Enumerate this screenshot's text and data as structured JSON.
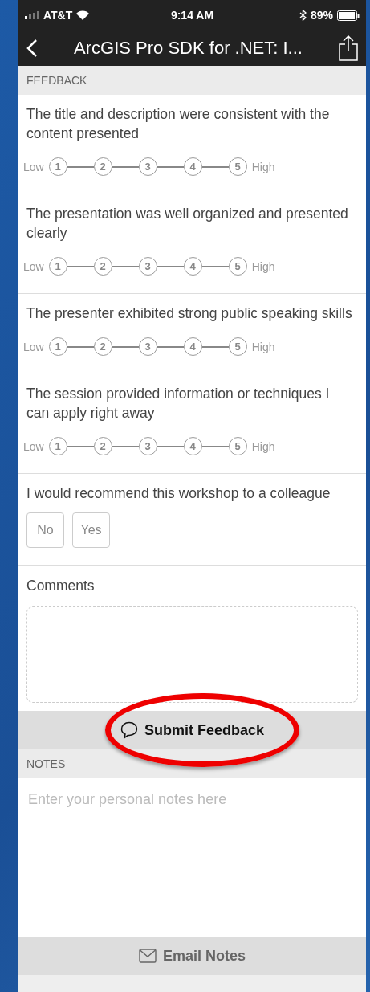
{
  "status_bar": {
    "carrier": "AT&T",
    "time": "9:14 AM",
    "battery": "89%"
  },
  "nav": {
    "title": "ArcGIS Pro SDK for .NET: I..."
  },
  "feedback": {
    "header": "FEEDBACK",
    "questions": [
      {
        "kind": "rating",
        "text": "The title and description were consistent with the content presented",
        "low": "Low",
        "high": "High",
        "options": [
          {
            "label": "1",
            "selected": false
          },
          {
            "label": "2",
            "selected": false
          },
          {
            "label": "3",
            "selected": false
          },
          {
            "label": "4",
            "selected": false
          },
          {
            "label": "5",
            "selected": false
          }
        ]
      },
      {
        "kind": "rating",
        "text": "The presentation was well organized and presented clearly",
        "low": "Low",
        "high": "High",
        "options": [
          {
            "label": "1",
            "selected": false
          },
          {
            "label": "2",
            "selected": false
          },
          {
            "label": "3",
            "selected": false
          },
          {
            "label": "4",
            "selected": false
          },
          {
            "label": "5",
            "selected": false
          }
        ]
      },
      {
        "kind": "rating",
        "text": "The presenter exhibited strong public speaking skills",
        "low": "Low",
        "high": "High",
        "options": [
          {
            "label": "1",
            "selected": false
          },
          {
            "label": "2",
            "selected": false
          },
          {
            "label": "3",
            "selected": false
          },
          {
            "label": "4",
            "selected": false
          },
          {
            "label": "5",
            "selected": false
          }
        ]
      },
      {
        "kind": "rating",
        "text": "The session provided information or techniques I can apply right away",
        "low": "Low",
        "high": "High",
        "options": [
          {
            "label": "1",
            "selected": false
          },
          {
            "label": "2",
            "selected": false
          },
          {
            "label": "3",
            "selected": false
          },
          {
            "label": "4",
            "selected": false
          },
          {
            "label": "5",
            "selected": false
          }
        ]
      },
      {
        "kind": "choice",
        "text": "I would recommend this workshop to a colleague",
        "options": [
          {
            "label": "No",
            "selected": false
          },
          {
            "label": "Yes",
            "selected": false
          }
        ]
      },
      {
        "kind": "comments",
        "text": "Comments"
      }
    ],
    "submit": "Submit Feedback"
  },
  "notes": {
    "header": "NOTES",
    "placeholder": "Enter your personal notes here",
    "email": "Email Notes"
  },
  "annotation": {
    "kind": "ellipse"
  }
}
